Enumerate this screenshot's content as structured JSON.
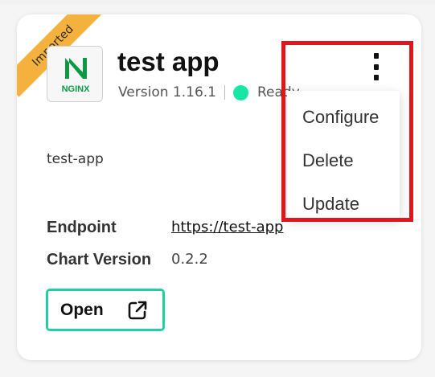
{
  "card": {
    "ribbon_label": "Imported",
    "logo_text": "NGINX",
    "title": "test app",
    "version": "Version 1.16.1",
    "status": "Ready",
    "status_color": "#17e6a5",
    "description": "test-app",
    "details": [
      {
        "label": "Endpoint",
        "value": "https://test-app"
      },
      {
        "label": "Chart Version",
        "value": "0.2.2"
      }
    ],
    "open_label": "Open"
  },
  "menu": {
    "items": [
      {
        "label": "Configure"
      },
      {
        "label": "Delete"
      },
      {
        "label": "Update"
      }
    ]
  },
  "colors": {
    "ribbon": "#f5b13d",
    "nginx_green": "#0a9a44",
    "open_border": "#1fd1a0",
    "highlight": "#e0161f"
  }
}
